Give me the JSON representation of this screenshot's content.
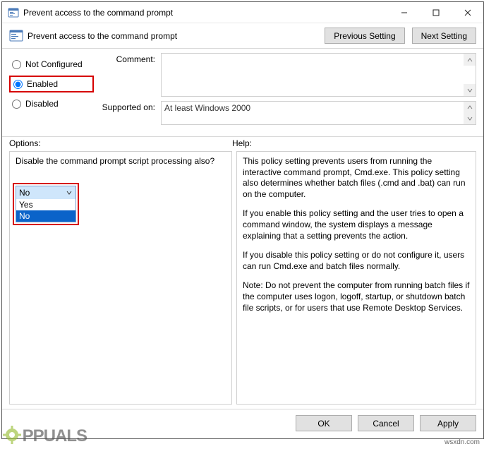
{
  "window": {
    "title": "Prevent access to the command prompt"
  },
  "header": {
    "title": "Prevent access to the command prompt",
    "prev_label": "Previous Setting",
    "next_label": "Next Setting"
  },
  "state_radios": {
    "not_configured": "Not Configured",
    "enabled": "Enabled",
    "disabled": "Disabled",
    "selected": "enabled"
  },
  "form": {
    "comment_label": "Comment:",
    "comment_value": "",
    "supported_label": "Supported on:",
    "supported_value": "At least Windows 2000"
  },
  "section_labels": {
    "options": "Options:",
    "help": "Help:"
  },
  "options": {
    "prompt_label": "Disable the command prompt script processing also?",
    "dropdown": {
      "selected": "No",
      "choices": [
        "Yes",
        "No"
      ],
      "highlighted": "No"
    }
  },
  "help": {
    "p1": "This policy setting prevents users from running the interactive command prompt, Cmd.exe.  This policy setting also determines whether batch files (.cmd and .bat) can run on the computer.",
    "p2": "If you enable this policy setting and the user tries to open a command window, the system displays a message explaining that a setting prevents the action.",
    "p3": "If you disable this policy setting or do not configure it, users can run Cmd.exe and batch files normally.",
    "p4": "Note: Do not prevent the computer from running batch files if the computer uses logon, logoff, startup, or shutdown batch file scripts, or for users that use Remote Desktop Services."
  },
  "footer": {
    "ok": "OK",
    "cancel": "Cancel",
    "apply": "Apply"
  },
  "watermark": {
    "brand": "PPUALS",
    "source": "wsxdn.com"
  }
}
